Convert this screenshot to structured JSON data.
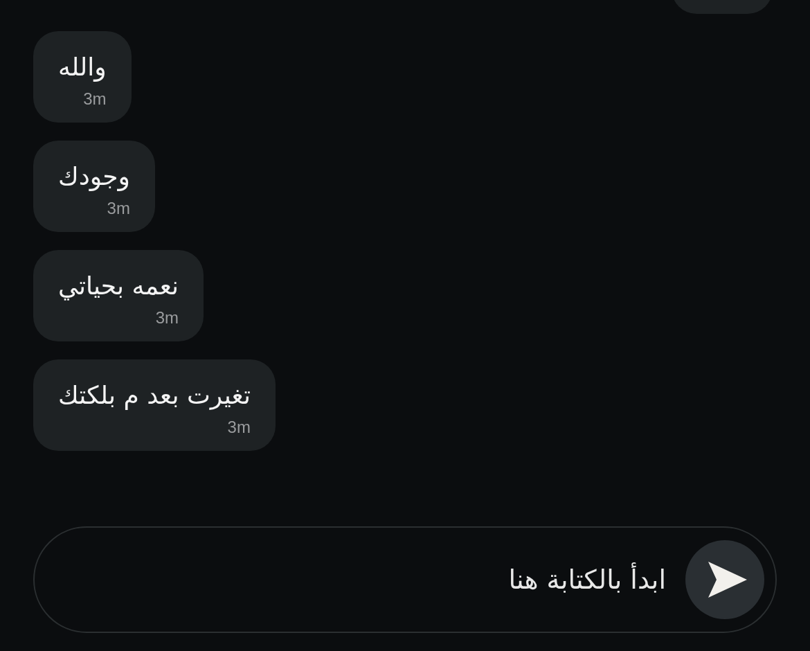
{
  "messages": [
    {
      "text": "والله",
      "time": "3m"
    },
    {
      "text": "وجودك",
      "time": "3m"
    },
    {
      "text": "نعمه بحياتي",
      "time": "3m"
    },
    {
      "text": "تغيرت بعد م بلكتك",
      "time": "3m"
    }
  ],
  "composer": {
    "placeholder": "ابدأ بالكتابة هنا"
  }
}
